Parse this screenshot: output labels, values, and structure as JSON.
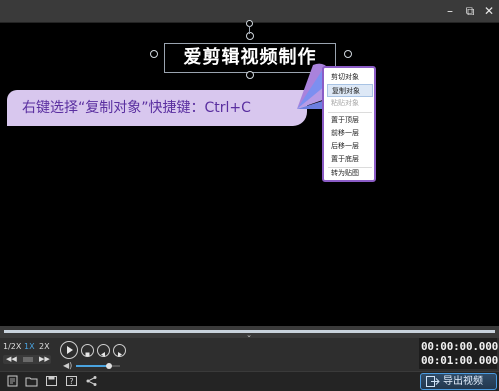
{
  "window": {
    "minimize_glyph": "–",
    "restore_glyph": "⧉",
    "close_glyph": "✕"
  },
  "canvas": {
    "title_text": "爱剪辑视频制作"
  },
  "context_menu": {
    "items": [
      "剪切对象",
      "复制对象",
      "粘贴对象",
      "置于顶层",
      "前移一层",
      "后移一层",
      "置于底层",
      "转为贴图"
    ],
    "highlighted_index": 1,
    "disabled_index": 2
  },
  "banner": {
    "text": "右键选择“复制对象”快捷键：Ctrl+C"
  },
  "player": {
    "speeds": [
      "1/2X",
      "1X",
      "2X"
    ],
    "active_speed": "1X",
    "current_time": "00:00:00.000",
    "total_time": "00:01:00.000",
    "volume_level": 0.75
  },
  "toolbar": {
    "export_label": "导出视频"
  },
  "colors": {
    "accent_purple": "#8b5cc6",
    "banner_bg": "#d8c7ee",
    "banner_text": "#5a2fa0",
    "time_blue": "#4aa3df"
  }
}
